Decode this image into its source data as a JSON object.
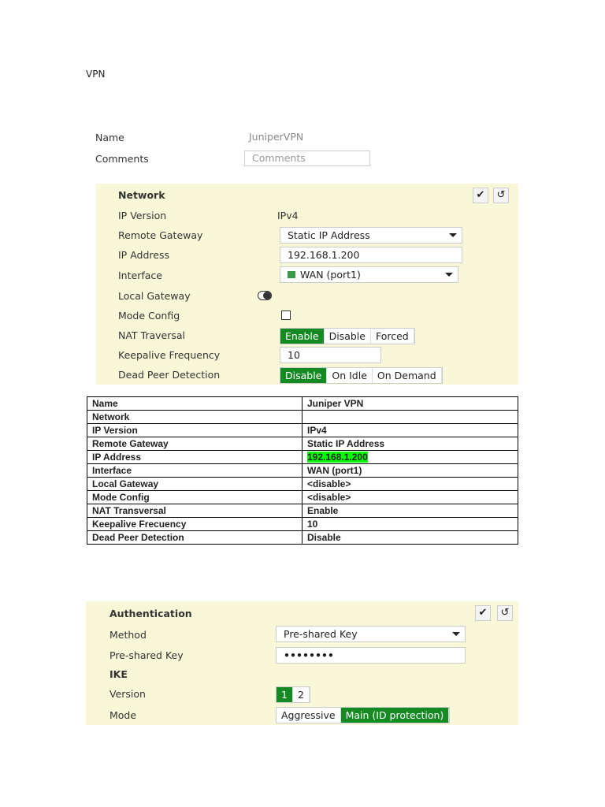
{
  "heading": "VPN",
  "name_label": "Name",
  "name_value": "JuniperVPN",
  "comments_label": "Comments",
  "comments_placeholder": "Comments",
  "network": {
    "title": "Network",
    "ip_version_label": "IP Version",
    "ip_version_value": "IPv4",
    "remote_gateway_label": "Remote Gateway",
    "remote_gateway_value": "Static IP Address",
    "ip_address_label": "IP Address",
    "ip_address_value": "192.168.1.200",
    "interface_label": "Interface",
    "interface_value": "WAN (port1)",
    "local_gateway_label": "Local Gateway",
    "mode_config_label": "Mode Config",
    "nat_label": "NAT Traversal",
    "nat_options": [
      "Enable",
      "Disable",
      "Forced"
    ],
    "keepalive_label": "Keepalive Frequency",
    "keepalive_value": "10",
    "dpd_label": "Dead Peer Detection",
    "dpd_options": [
      "Disable",
      "On Idle",
      "On Demand"
    ]
  },
  "table": [
    [
      "Name",
      "Juniper VPN"
    ],
    [
      "Network",
      ""
    ],
    [
      "IP Version",
      "IPv4"
    ],
    [
      "Remote Gateway",
      "Static IP Address"
    ],
    [
      "IP Address",
      "192.168.1.200"
    ],
    [
      "Interface",
      "WAN (port1)"
    ],
    [
      "Local Gateway",
      "<disable>"
    ],
    [
      "Mode Config",
      "<disable>"
    ],
    [
      "NAT Transversal",
      "Enable"
    ],
    [
      "Keepalive Frecuency",
      "10"
    ],
    [
      "Dead Peer Detection",
      "Disable"
    ]
  ],
  "auth": {
    "title": "Authentication",
    "method_label": "Method",
    "method_value": "Pre-shared Key",
    "psk_label": "Pre-shared Key",
    "psk_value": "••••••••",
    "ike_label": "IKE",
    "version_label": "Version",
    "version_options": [
      "1",
      "2"
    ],
    "mode_label": "Mode",
    "mode_options": [
      "Aggressive",
      "Main (ID protection)"
    ]
  }
}
